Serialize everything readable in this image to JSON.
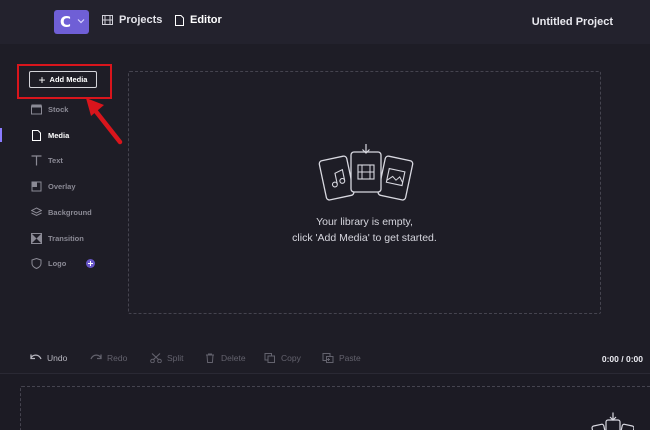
{
  "topbar": {
    "logo_letter": "C",
    "projects_label": "Projects",
    "editor_label": "Editor",
    "project_title": "Untitled Project"
  },
  "sidebar": {
    "add_media_label": "Add Media",
    "items": [
      {
        "label": "Stock",
        "icon": "stock-icon"
      },
      {
        "label": "Media",
        "icon": "media-file-icon",
        "active": true
      },
      {
        "label": "Text",
        "icon": "text-icon"
      },
      {
        "label": "Overlay",
        "icon": "overlay-icon"
      },
      {
        "label": "Background",
        "icon": "layers-icon"
      },
      {
        "label": "Transition",
        "icon": "transition-icon"
      },
      {
        "label": "Logo",
        "icon": "shield-icon"
      }
    ]
  },
  "library": {
    "empty_line1": "Your library is empty,",
    "empty_line2": "click 'Add Media' to get started."
  },
  "toolbar": {
    "undo": "Undo",
    "redo": "Redo",
    "split": "Split",
    "delete": "Delete",
    "copy": "Copy",
    "paste": "Paste",
    "time": "0:00 / 0:00"
  },
  "colors": {
    "accent": "#6f5fd6",
    "annotation": "#d9151c",
    "background": "#1e1d26"
  }
}
